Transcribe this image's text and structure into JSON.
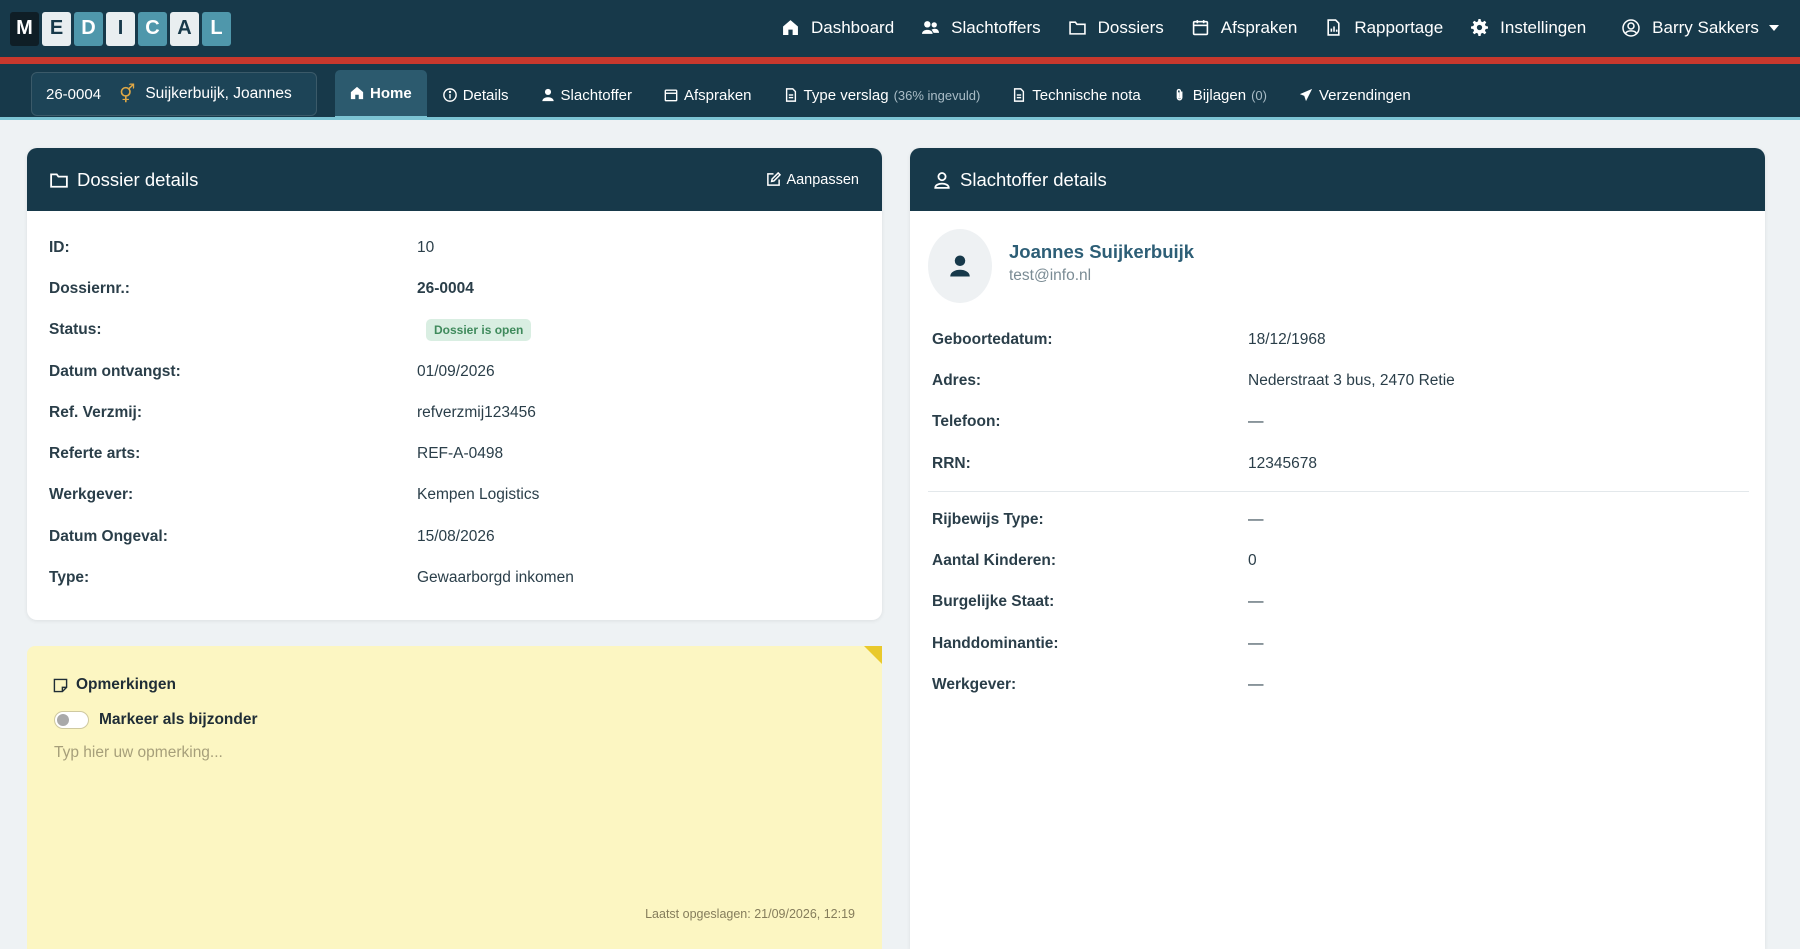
{
  "logo": {
    "letters": [
      "M",
      "E",
      "D",
      "I",
      "C",
      "A",
      "L"
    ]
  },
  "topnav": {
    "items": [
      {
        "label": "Dashboard",
        "icon": "home-icon"
      },
      {
        "label": "Slachtoffers",
        "icon": "users-icon"
      },
      {
        "label": "Dossiers",
        "icon": "folder-icon"
      },
      {
        "label": "Afspraken",
        "icon": "calendar-icon"
      },
      {
        "label": "Rapportage",
        "icon": "report-icon"
      },
      {
        "label": "Instellingen",
        "icon": "gear-icon"
      }
    ],
    "user": "Barry Sakkers"
  },
  "case": {
    "number": "26-0004",
    "gender_symbol": "⚥",
    "name": "Suijkerbuijk, Joannes"
  },
  "subnav": {
    "home": "Home",
    "details": "Details",
    "slachtoffer": "Slachtoffer",
    "afspraken": "Afspraken",
    "type_verslag": "Type verslag",
    "type_verslag_note": "(36% ingevuld)",
    "technische_nota": "Technische nota",
    "bijlagen": "Bijlagen",
    "bijlagen_count": "(0)",
    "verzendingen": "Verzendingen"
  },
  "dossier": {
    "title": "Dossier details",
    "edit_label": "Aanpassen",
    "rows": [
      {
        "label": "ID:",
        "value": "10"
      },
      {
        "label": "Dossiernr.:",
        "value": "26-0004"
      },
      {
        "label": "Status:",
        "value": "Dossier is open"
      },
      {
        "label": "Datum ontvangst:",
        "value": "01/09/2026"
      },
      {
        "label": "Ref. Verzmij:",
        "value": "refverzmij123456"
      },
      {
        "label": "Referte arts:",
        "value": "REF-A-0498"
      },
      {
        "label": "Werkgever:",
        "value": "Kempen Logistics"
      },
      {
        "label": "Datum Ongeval:",
        "value": "15/08/2026"
      },
      {
        "label": "Type:",
        "value": "Gewaarborgd inkomen"
      }
    ]
  },
  "notes": {
    "title": "Opmerkingen",
    "toggle_label": "Markeer als bijzonder",
    "placeholder": "Typ hier uw opmerking...",
    "saved": "Laatst opgeslagen: 21/09/2026, 12:19"
  },
  "victim": {
    "title": "Slachtoffer details",
    "name": "Joannes Suijkerbuijk",
    "email": "test@info.nl",
    "rows_a": [
      {
        "label": "Geboortedatum:",
        "value": "18/12/1968"
      },
      {
        "label": "Adres:",
        "value": "Nederstraat 3 bus, 2470 Retie"
      },
      {
        "label": "Telefoon:",
        "value": "—"
      },
      {
        "label": "RRN:",
        "value": "12345678"
      }
    ],
    "rows_b": [
      {
        "label": "Rijbewijs Type:",
        "value": "—"
      },
      {
        "label": "Aantal Kinderen:",
        "value": "0"
      },
      {
        "label": "Burgelijke Staat:",
        "value": "—"
      },
      {
        "label": "Handdominantie:",
        "value": "—"
      },
      {
        "label": "Werkgever:",
        "value": "—"
      }
    ]
  },
  "colors": {
    "navy": "#17394a",
    "accent_red": "#c8382d",
    "accent_teal": "#7cc4d4",
    "note_yellow": "#fcf6c2"
  }
}
